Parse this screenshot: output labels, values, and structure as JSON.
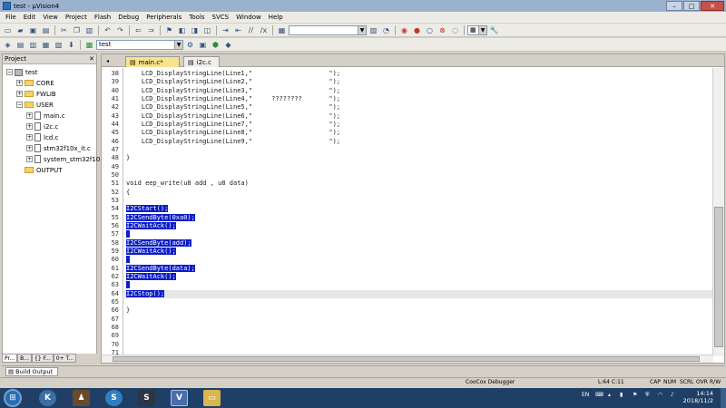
{
  "window": {
    "title": "test - µVision4",
    "controls": {
      "minimize": "–",
      "maximize": "□",
      "close": "✕"
    }
  },
  "menu": [
    "File",
    "Edit",
    "View",
    "Project",
    "Flash",
    "Debug",
    "Peripherals",
    "Tools",
    "SVCS",
    "Window",
    "Help"
  ],
  "toolbar2": {
    "target_value": "test"
  },
  "project_panel": {
    "title": "Project",
    "tree": [
      {
        "label": "test",
        "level": 0,
        "kind": "root",
        "expander": "−"
      },
      {
        "label": "CORE",
        "level": 1,
        "kind": "folder",
        "expander": "+"
      },
      {
        "label": "FWLIB",
        "level": 1,
        "kind": "folder",
        "expander": "+"
      },
      {
        "label": "USER",
        "level": 1,
        "kind": "folder",
        "expander": "−"
      },
      {
        "label": "main.c",
        "level": 2,
        "kind": "file",
        "expander": "+"
      },
      {
        "label": "i2c.c",
        "level": 2,
        "kind": "file",
        "expander": "+"
      },
      {
        "label": "lcd.c",
        "level": 2,
        "kind": "file",
        "expander": "+"
      },
      {
        "label": "stm32f10x_it.c",
        "level": 2,
        "kind": "file",
        "expander": "+"
      },
      {
        "label": "system_stm32f10",
        "level": 2,
        "kind": "file",
        "expander": "+"
      },
      {
        "label": "OUTPUT",
        "level": 1,
        "kind": "folder",
        "expander": ""
      }
    ],
    "bottom_tabs": [
      "Pr...",
      "B...",
      "{} F...",
      "0+ T..."
    ]
  },
  "editor": {
    "tabs": [
      {
        "label": "main.c*",
        "active": true
      },
      {
        "label": "i2c.c",
        "active": false
      }
    ],
    "lines": [
      {
        "n": "38",
        "text": "    LCD_DisplayStringLine(Line1,\"                    \");",
        "sel": false
      },
      {
        "n": "39",
        "text": "    LCD_DisplayStringLine(Line2,\"                    \");",
        "sel": false
      },
      {
        "n": "40",
        "text": "    LCD_DisplayStringLine(Line3,\"                    \");",
        "sel": false
      },
      {
        "n": "41",
        "text": "    LCD_DisplayStringLine(Line4,\"     ????????       \");",
        "sel": false
      },
      {
        "n": "42",
        "text": "    LCD_DisplayStringLine(Line5,\"                    \");",
        "sel": false
      },
      {
        "n": "43",
        "text": "    LCD_DisplayStringLine(Line6,\"                    \");",
        "sel": false
      },
      {
        "n": "44",
        "text": "    LCD_DisplayStringLine(Line7,\"                    \");",
        "sel": false
      },
      {
        "n": "45",
        "text": "    LCD_DisplayStringLine(Line8,\"                    \");",
        "sel": false
      },
      {
        "n": "46",
        "text": "    LCD_DisplayStringLine(Line9,\"                    \");",
        "sel": false
      },
      {
        "n": "47",
        "text": "",
        "sel": false
      },
      {
        "n": "48",
        "text": "}",
        "sel": false
      },
      {
        "n": "49",
        "text": "",
        "sel": false
      },
      {
        "n": "50",
        "text": "",
        "sel": false
      },
      {
        "n": "51",
        "text": "void eep_write(u8 add , u8 data)",
        "sel": false
      },
      {
        "n": "52",
        "text": "{",
        "sel": false
      },
      {
        "n": "53",
        "text": "",
        "sel": false
      },
      {
        "n": "54",
        "text": "I2CStart();",
        "sel": true
      },
      {
        "n": "55",
        "text": "I2CSendByte(0xa0);",
        "sel": true
      },
      {
        "n": "56",
        "text": "I2CWaitAck();",
        "sel": true
      },
      {
        "n": "57",
        "text": " ",
        "sel": true
      },
      {
        "n": "58",
        "text": "I2CSendByte(add);",
        "sel": true
      },
      {
        "n": "59",
        "text": "I2CWaitAck();",
        "sel": true
      },
      {
        "n": "60",
        "text": " ",
        "sel": true
      },
      {
        "n": "61",
        "text": "I2CSendByte(data);",
        "sel": true
      },
      {
        "n": "62",
        "text": "I2CWaitAck();",
        "sel": true
      },
      {
        "n": "63",
        "text": " ",
        "sel": true
      },
      {
        "n": "64",
        "text": "I2CStop();",
        "sel": true
      },
      {
        "n": "65",
        "text": "",
        "sel": false
      },
      {
        "n": "66",
        "text": "}",
        "sel": false
      },
      {
        "n": "67",
        "text": "",
        "sel": false
      },
      {
        "n": "68",
        "text": "",
        "sel": false
      },
      {
        "n": "69",
        "text": "",
        "sel": false
      },
      {
        "n": "70",
        "text": "",
        "sel": false
      },
      {
        "n": "71",
        "text": "",
        "sel": false
      }
    ],
    "current_line": "64"
  },
  "build_output": {
    "label": "Build Output"
  },
  "status": {
    "debugger": "CooCox Debugger",
    "position": "L:64 C:11",
    "caps": "CAP",
    "num": "NUM",
    "scrl": "SCRL",
    "ovr": "OVR",
    "rw": "R/W"
  },
  "taskbar": {
    "time": "14:14",
    "date": "2018/11/2",
    "lang": "EN"
  }
}
